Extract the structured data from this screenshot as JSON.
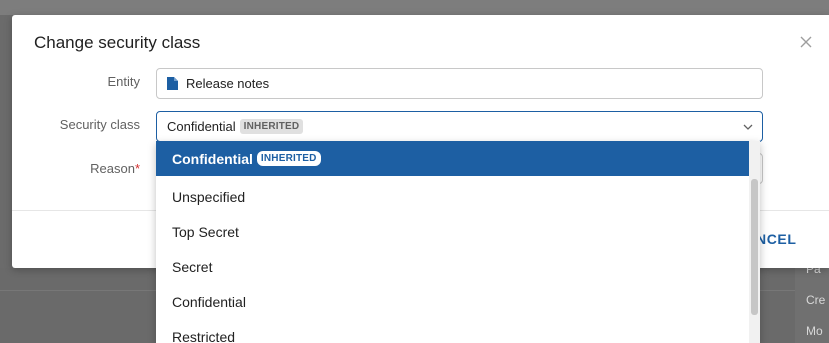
{
  "background": {
    "right_texts": [
      "Pa",
      "Cre",
      "Mo"
    ]
  },
  "dialog": {
    "title": "Change security class",
    "close_icon": "close-icon",
    "fields": {
      "entity": {
        "label": "Entity",
        "value": "Release notes",
        "icon": "document-icon"
      },
      "security_class": {
        "label": "Security class",
        "value": "Confidential",
        "badge": "INHERITED",
        "icon": "chevron-down-icon"
      },
      "reason": {
        "label": "Reason",
        "required_mark": "*"
      }
    },
    "footer": {
      "cancel_label": "NCEL"
    }
  },
  "dropdown": {
    "options": [
      {
        "label": "Confidential",
        "badge": "INHERITED",
        "selected": true
      },
      {
        "label": "Unspecified",
        "selected": false
      },
      {
        "label": "Top Secret",
        "selected": false
      },
      {
        "label": "Secret",
        "selected": false
      },
      {
        "label": "Confidential",
        "selected": false
      },
      {
        "label": "Restricted",
        "selected": false
      }
    ]
  },
  "colors": {
    "accent": "#1d5fa3",
    "required": "#d32f2f",
    "overlay": "#6b6b6b"
  }
}
